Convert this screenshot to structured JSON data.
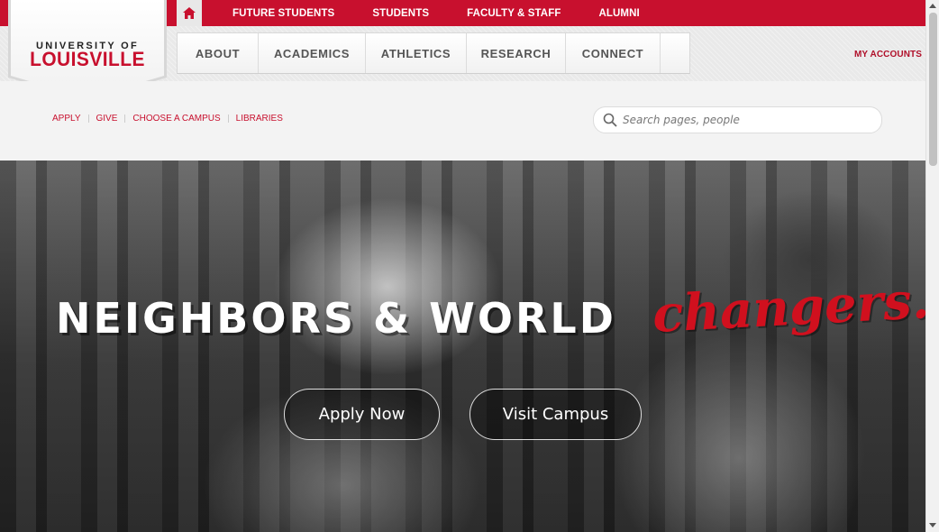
{
  "topbar": {
    "home_icon": "home-icon",
    "links": [
      "FUTURE STUDENTS",
      "STUDENTS",
      "FACULTY & STAFF",
      "ALUMNI"
    ]
  },
  "logo": {
    "line1": "UNIVERSITY OF",
    "line2": "LOUISVILLE"
  },
  "mainnav": {
    "items": [
      "ABOUT",
      "ACADEMICS",
      "ATHLETICS",
      "RESEARCH",
      "CONNECT"
    ]
  },
  "my_accounts": "MY ACCOUNTS",
  "quicklinks": [
    "APPLY",
    "GIVE",
    "CHOOSE A CAMPUS",
    "LIBRARIES"
  ],
  "search": {
    "placeholder": "Search pages, people",
    "icon": "search-icon"
  },
  "hero": {
    "headline": "NEIGHBORS & WORLD",
    "accent": "changers.",
    "apply_button": "Apply Now",
    "visit_button": "Visit Campus"
  },
  "colors": {
    "brand_red": "#c8102e",
    "nav_text": "#555555"
  }
}
